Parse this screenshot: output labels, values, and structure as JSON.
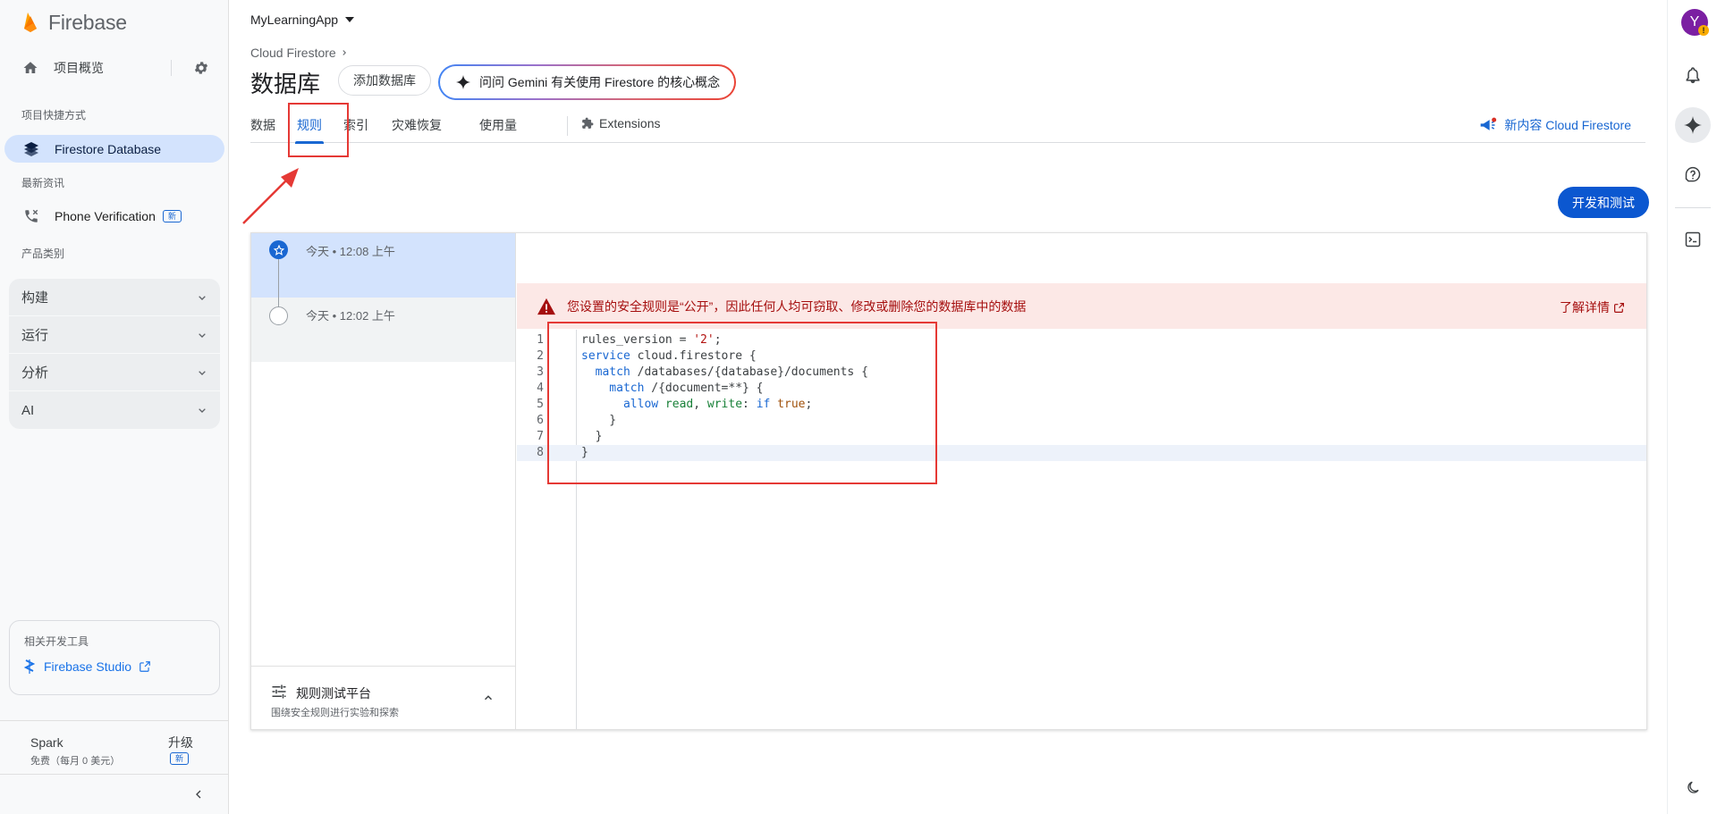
{
  "brand": {
    "name": "Firebase"
  },
  "sidebar": {
    "overview_label": "项目概览",
    "shortcuts_label": "项目快捷方式",
    "firestore_label": "Firestore Database",
    "news_label": "最新资讯",
    "phone_label": "Phone Verification",
    "phone_badge": "新",
    "categories_label": "产品类别",
    "categories": [
      {
        "label": "构建"
      },
      {
        "label": "运行"
      },
      {
        "label": "分析"
      },
      {
        "label": "AI"
      }
    ],
    "devtools_label": "相关开发工具",
    "studio_label": "Firebase Studio",
    "plan_name": "Spark",
    "plan_desc": "免费（每月 0 美元）",
    "upgrade_label": "升级",
    "upgrade_badge": "新"
  },
  "header": {
    "project": "MyLearningApp",
    "breadcrumb": "Cloud Firestore",
    "title": "数据库",
    "add_db": "添加数据库",
    "gemini": "问问 Gemini 有关使用 Firestore 的核心概念"
  },
  "tabs": [
    {
      "label": "数据"
    },
    {
      "label": "规则"
    },
    {
      "label": "索引"
    },
    {
      "label": "灾难恢复"
    },
    {
      "label": "使用量"
    }
  ],
  "extensions_tab": "Extensions",
  "whats_new": "新内容 Cloud Firestore",
  "dev_button": "开发和测试",
  "history": [
    {
      "time": "今天 • 12:08 上午"
    },
    {
      "time": "今天 • 12:02 上午"
    }
  ],
  "playground": {
    "title": "规则测试平台",
    "subtitle": "围绕安全规则进行实验和探索"
  },
  "warning": {
    "text": "您设置的安全规则是“公开”，因此任何人均可窃取、修改或删除您的数据库中的数据",
    "link": "了解详情"
  },
  "code": {
    "line_numbers": [
      "1",
      "2",
      "3",
      "4",
      "5",
      "6",
      "7",
      "8"
    ],
    "l1_a": "rules_version = ",
    "l1_b": "'2'",
    "l1_c": ";",
    "l2_a": "service",
    "l2_b": " cloud.firestore {",
    "l3_a": "  match",
    "l3_b": " /databases/{database}/documents {",
    "l4_a": "    match",
    "l4_b": " /{document=**} {",
    "l5_a": "      allow",
    "l5_b": " read",
    "l5_c": ", ",
    "l5_d": "write",
    "l5_e": ": ",
    "l5_f": "if",
    "l5_g": " true",
    "l5_h": ";",
    "l6": "    }",
    "l7": "  }",
    "l8": "}"
  },
  "user": {
    "initial": "Y",
    "badge": "!"
  },
  "colors": {
    "accent": "#1967d2",
    "primary_button": "#0b57d0",
    "warning_bg": "#fce8e6",
    "warning_text": "#a50e0e",
    "annotation": "#e53935"
  }
}
